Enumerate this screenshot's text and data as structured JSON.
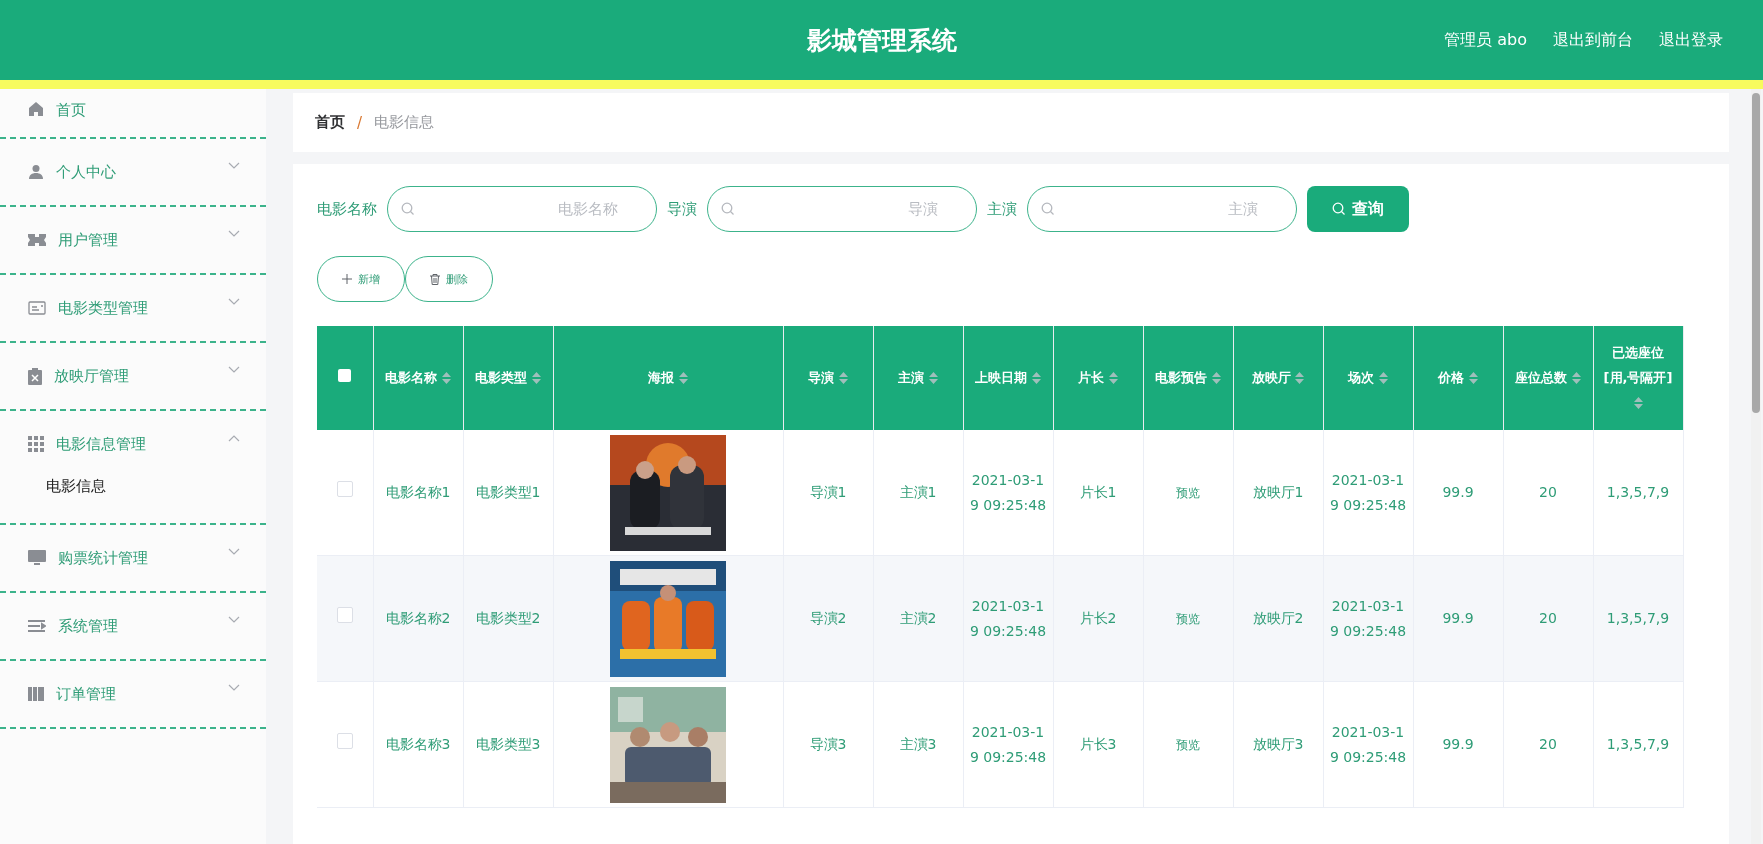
{
  "header": {
    "title": "影城管理系统",
    "links": [
      "管理员 abo",
      "退出到前台",
      "退出登录"
    ]
  },
  "sidebar": {
    "items": [
      {
        "label": "首页",
        "kind": "link"
      },
      {
        "label": "个人中心",
        "kind": "submenu",
        "expanded": false
      },
      {
        "label": "用户管理",
        "kind": "submenu",
        "expanded": false
      },
      {
        "label": "电影类型管理",
        "kind": "submenu",
        "expanded": false
      },
      {
        "label": "放映厅管理",
        "kind": "submenu",
        "expanded": false
      },
      {
        "label": "电影信息管理",
        "kind": "submenu",
        "expanded": true,
        "children": [
          {
            "label": "电影信息"
          }
        ]
      },
      {
        "label": "购票统计管理",
        "kind": "submenu",
        "expanded": false
      },
      {
        "label": "系统管理",
        "kind": "submenu",
        "expanded": false
      },
      {
        "label": "订单管理",
        "kind": "submenu",
        "expanded": false
      }
    ]
  },
  "breadcrumb": {
    "items": [
      "首页",
      "电影信息"
    ],
    "separator": "/"
  },
  "search": {
    "fields": [
      {
        "label": "电影名称",
        "placeholder": "电影名称"
      },
      {
        "label": "导演",
        "placeholder": "导演"
      },
      {
        "label": "主演",
        "placeholder": "主演"
      }
    ],
    "button": "查询"
  },
  "actions": [
    {
      "label": "新增",
      "kind": "add"
    },
    {
      "label": "删除",
      "kind": "delete"
    }
  ],
  "table": {
    "select_all_checked": false,
    "columns": [
      {
        "label": "电影名称",
        "kind": "text"
      },
      {
        "label": "电影类型",
        "kind": "text"
      },
      {
        "label": "海报",
        "kind": "poster"
      },
      {
        "label": "导演",
        "kind": "text"
      },
      {
        "label": "主演",
        "kind": "text"
      },
      {
        "label": "上映日期",
        "kind": "text"
      },
      {
        "label": "片长",
        "kind": "text"
      },
      {
        "label": "电影预告",
        "kind": "link"
      },
      {
        "label": "放映厅",
        "kind": "text"
      },
      {
        "label": "场次",
        "kind": "text"
      },
      {
        "label": "价格",
        "kind": "text"
      },
      {
        "label": "座位总数",
        "kind": "text"
      },
      {
        "label": "已选座位[用,号隔开]",
        "kind": "text"
      }
    ],
    "rows": [
      {
        "checked": false,
        "cells": [
          "电影名称1",
          "电影类型1",
          {
            "kind": "picture"
          },
          "导演1",
          "主演1",
          "2021-03-19 09:25:48",
          "片长1",
          "预览",
          "放映厅1",
          "2021-03-19 09:25:48",
          "99.9",
          "20",
          "1,3,5,7,9"
        ]
      },
      {
        "checked": false,
        "cells": [
          "电影名称2",
          "电影类型2",
          {
            "kind": "picture"
          },
          "导演2",
          "主演2",
          "2021-03-19 09:25:48",
          "片长2",
          "预览",
          "放映厅2",
          "2021-03-19 09:25:48",
          "99.9",
          "20",
          "1,3,5,7,9"
        ]
      },
      {
        "checked": false,
        "cells": [
          "电影名称3",
          "电影类型3",
          {
            "kind": "picture"
          },
          "导演3",
          "主演3",
          "2021-03-19 09:25:48",
          "片长3",
          "预览",
          "放映厅3",
          "2021-03-19 09:25:48",
          "99.9",
          "20",
          "1,3,5,7,9"
        ]
      }
    ]
  }
}
